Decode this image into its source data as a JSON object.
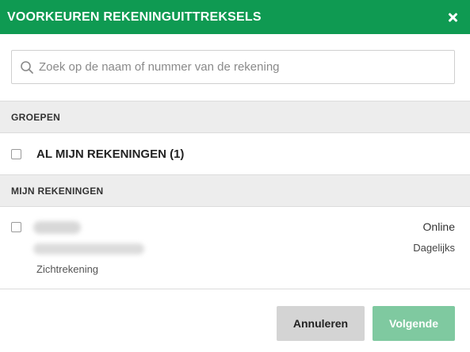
{
  "header": {
    "title": "VOORKEUREN REKENINGUITTREKSELS",
    "close_icon": "close-icon"
  },
  "search": {
    "placeholder": "Zoek op de naam of nummer van de rekening",
    "value": "",
    "icon": "search-icon"
  },
  "groups": {
    "heading": "GROEPEN",
    "items": [
      {
        "label": "AL MIJN REKENINGEN (1)",
        "checked": false
      }
    ]
  },
  "accounts": {
    "heading": "MIJN REKENINGEN",
    "items": [
      {
        "type": "Zichtrekening",
        "status": "Online",
        "frequency": "Dagelijks",
        "checked": false
      }
    ]
  },
  "footer": {
    "cancel_label": "Annuleren",
    "next_label": "Volgende"
  },
  "colors": {
    "header": "#0f9a52",
    "next_button": "#7fc9a0",
    "cancel_button": "#d4d4d4",
    "section": "#ededed"
  }
}
